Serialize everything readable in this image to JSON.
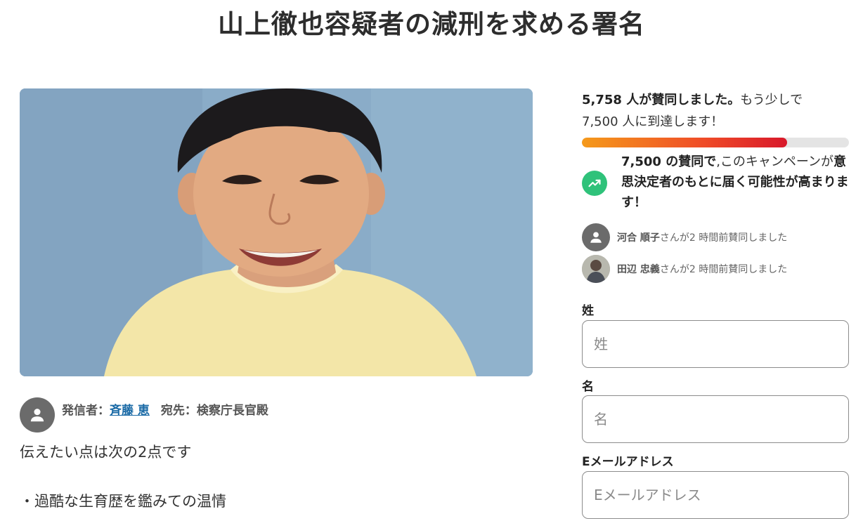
{
  "page": {
    "title": "山上徹也容疑者の減刑を求める署名"
  },
  "starter": {
    "label": "発信者：",
    "name": "斉藤 恵",
    "recipient": "宛先：検察庁長官殿"
  },
  "body": {
    "p1": "伝えたい点は次の2点です",
    "p2": "・過酷な生育歴を鑑みての温情"
  },
  "progress": {
    "count_bold": "5,758 人が賛同しました。",
    "count_rest": "もう少しで",
    "target_line": "7,500 人に到達します！",
    "fraction": 0.7677,
    "color_start": "#f59a1b",
    "color_end": "#d8182a"
  },
  "goal": {
    "bold_part": "7,500 の賛同で",
    "normal_part": ",このキャンペーンが",
    "bold_rest": "意思決定者のもとに届く可能性が高まります！",
    "icon": "trending-up-icon",
    "icon_color": "#2fc27a"
  },
  "recent_signers": [
    {
      "name": "河合 順子",
      "suffix": "さんが2 時間前賛同しました",
      "avatar": "person-icon"
    },
    {
      "name": "田辺 忠義",
      "suffix": "さんが2 時間前賛同しました",
      "avatar": "photo"
    }
  ],
  "form": {
    "last_name_label": "姓",
    "last_name_placeholder": "姓",
    "first_name_label": "名",
    "first_name_placeholder": "名",
    "email_label": "Eメールアドレス",
    "email_placeholder": "Eメールアドレス"
  }
}
